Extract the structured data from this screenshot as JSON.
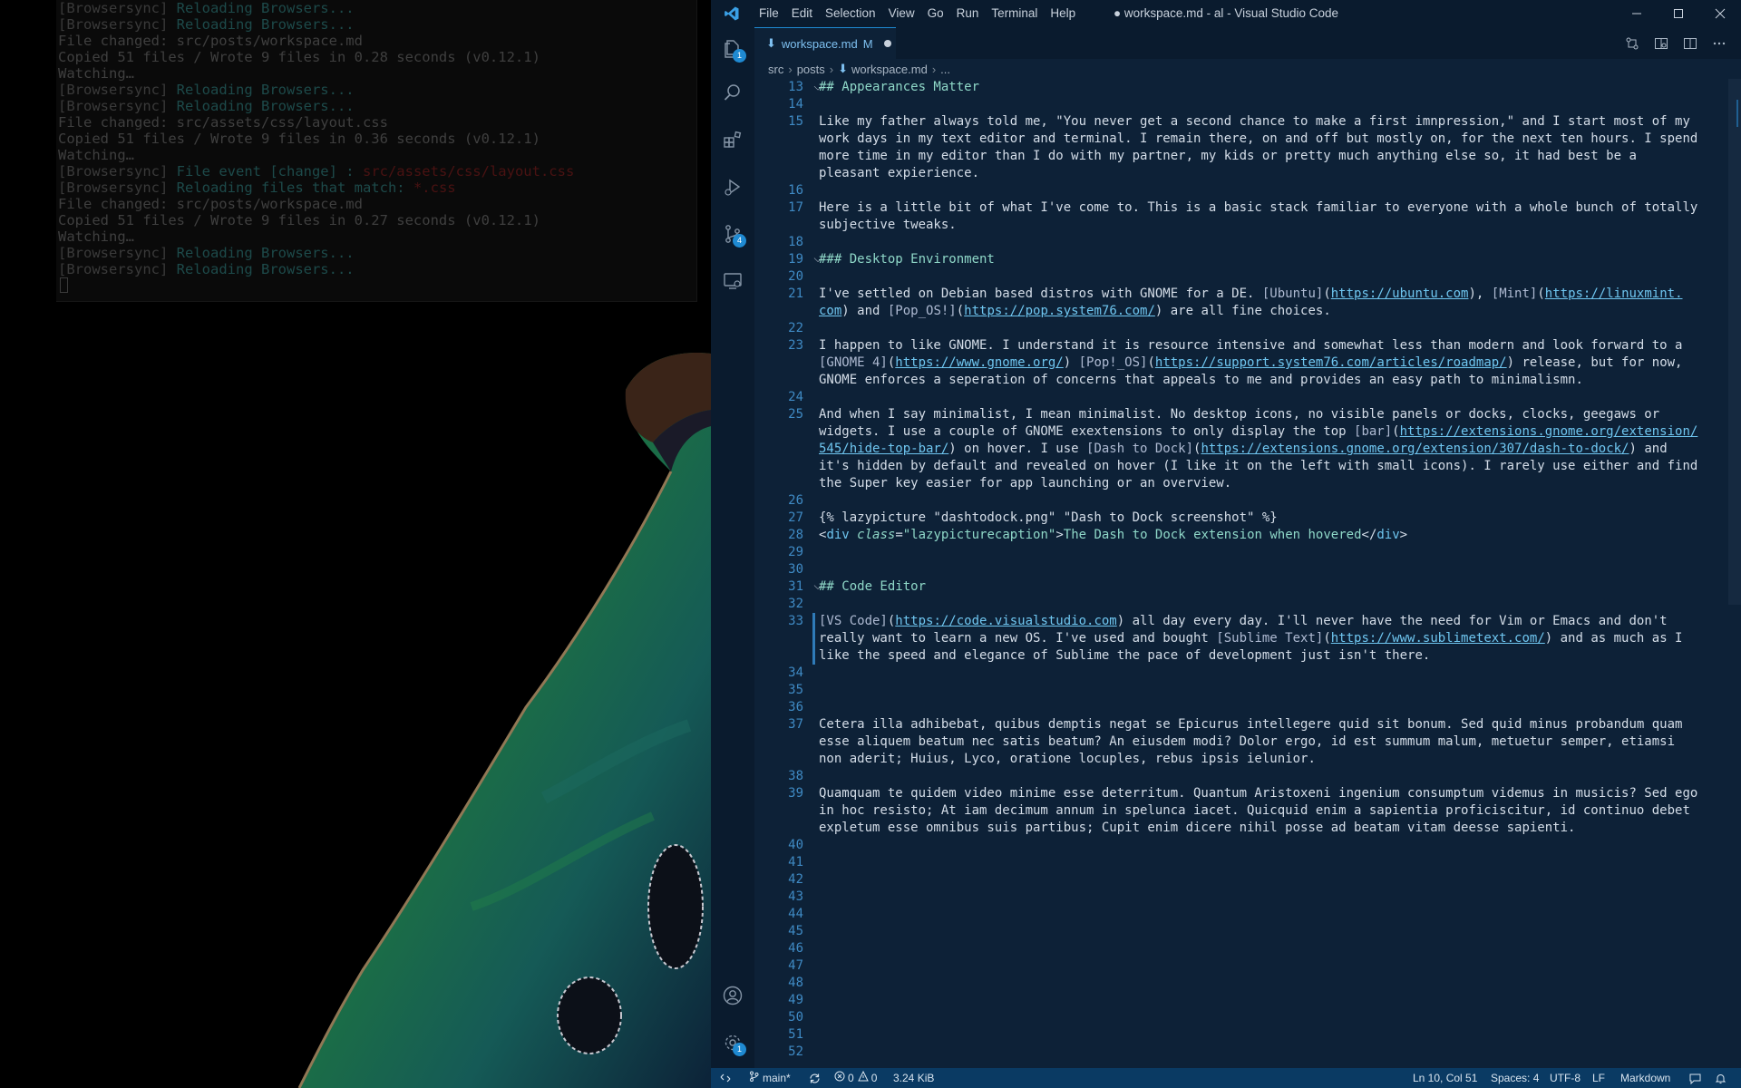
{
  "terminal": {
    "lines": [
      [
        {
          "t": "[",
          "c": "b"
        },
        {
          "t": "Browsersync",
          "c": "b"
        },
        {
          "t": "] ",
          "c": "b"
        },
        {
          "t": "Reloading Browsers...",
          "c": "cyan"
        }
      ],
      [
        {
          "t": "[",
          "c": "b"
        },
        {
          "t": "Browsersync",
          "c": "b"
        },
        {
          "t": "] ",
          "c": "b"
        },
        {
          "t": "Reloading Browsers...",
          "c": "cyan"
        }
      ],
      [
        {
          "t": "File changed: src/posts/workspace.md",
          "c": "n"
        }
      ],
      [
        {
          "t": "Copied 51 files / Wrote 9 files in 0.28 seconds (v0.12.1)",
          "c": "n"
        }
      ],
      [
        {
          "t": "Watching…",
          "c": "n"
        }
      ],
      [
        {
          "t": "[",
          "c": "b"
        },
        {
          "t": "Browsersync",
          "c": "b"
        },
        {
          "t": "] ",
          "c": "b"
        },
        {
          "t": "Reloading Browsers...",
          "c": "cyan"
        }
      ],
      [
        {
          "t": "[",
          "c": "b"
        },
        {
          "t": "Browsersync",
          "c": "b"
        },
        {
          "t": "] ",
          "c": "b"
        },
        {
          "t": "Reloading Browsers...",
          "c": "cyan"
        }
      ],
      [
        {
          "t": "File changed: src/assets/css/layout.css",
          "c": "n"
        }
      ],
      [
        {
          "t": "Copied 51 files / Wrote 9 files in 0.36 seconds (v0.12.1)",
          "c": "n"
        }
      ],
      [
        {
          "t": "Watching…",
          "c": "n"
        }
      ],
      [
        {
          "t": "[",
          "c": "b"
        },
        {
          "t": "Browsersync",
          "c": "b"
        },
        {
          "t": "] ",
          "c": "b"
        },
        {
          "t": "File event [change] : ",
          "c": "cyan"
        },
        {
          "t": "src/assets/css/layout.css",
          "c": "red"
        }
      ],
      [
        {
          "t": "[",
          "c": "b"
        },
        {
          "t": "Browsersync",
          "c": "b"
        },
        {
          "t": "] ",
          "c": "b"
        },
        {
          "t": "Reloading files that match: ",
          "c": "cyan"
        },
        {
          "t": "*.css",
          "c": "red"
        }
      ],
      [
        {
          "t": "File changed: src/posts/workspace.md",
          "c": "n"
        }
      ],
      [
        {
          "t": "Copied 51 files / Wrote 9 files in 0.27 seconds (v0.12.1)",
          "c": "n"
        }
      ],
      [
        {
          "t": "Watching…",
          "c": "n"
        }
      ],
      [
        {
          "t": "[",
          "c": "b"
        },
        {
          "t": "Browsersync",
          "c": "b"
        },
        {
          "t": "] ",
          "c": "b"
        },
        {
          "t": "Reloading Browsers...",
          "c": "cyan"
        }
      ],
      [
        {
          "t": "[",
          "c": "b"
        },
        {
          "t": "Browsersync",
          "c": "b"
        },
        {
          "t": "] ",
          "c": "b"
        },
        {
          "t": "Reloading Browsers...",
          "c": "cyan"
        }
      ]
    ]
  },
  "vscode": {
    "menu": [
      "File",
      "Edit",
      "Selection",
      "View",
      "Go",
      "Run",
      "Terminal",
      "Help"
    ],
    "window_title": "● workspace.md - al - Visual Studio Code",
    "activity_badges": {
      "explorer": "1",
      "source_control": "4",
      "settings": "1"
    },
    "tab": {
      "label": "workspace.md",
      "status": "M"
    },
    "breadcrumb": [
      "src",
      "posts",
      "workspace.md",
      "..."
    ],
    "editor_lines": [
      {
        "n": "13",
        "fold": true,
        "segs": [
          [
            "h",
            "## Appearances Matter"
          ]
        ]
      },
      {
        "n": "14",
        "segs": []
      },
      {
        "n": "15",
        "segs": [
          [
            "n",
            "Like my father always told me, \"You never get a second chance to make a first imnpression,\" and I start most of my"
          ]
        ]
      },
      {
        "n": "",
        "segs": [
          [
            "n",
            "work days in my text editor and terminal. I remain there, on and off but mostly on, for the next ten hours. I spend"
          ]
        ]
      },
      {
        "n": "",
        "segs": [
          [
            "n",
            "more time in my editor than I do with my partner, my kids or pretty much anything else so, it had best be a"
          ]
        ]
      },
      {
        "n": "",
        "segs": [
          [
            "n",
            "pleasant expierience."
          ]
        ]
      },
      {
        "n": "16",
        "segs": []
      },
      {
        "n": "17",
        "segs": [
          [
            "n",
            "Here is a little bit of what I've come to. This is a basic stack familiar to everyone with a whole bunch of totally"
          ]
        ]
      },
      {
        "n": "",
        "segs": [
          [
            "n",
            "subjective tweaks."
          ]
        ]
      },
      {
        "n": "18",
        "segs": []
      },
      {
        "n": "19",
        "fold": true,
        "segs": [
          [
            "h",
            "### Desktop Environment"
          ]
        ]
      },
      {
        "n": "20",
        "segs": []
      },
      {
        "n": "21",
        "segs": [
          [
            "n",
            "I've settled on Debian based distros with GNOME for a DE. "
          ],
          [
            "br",
            "[Ubuntu]"
          ],
          [
            "n",
            "("
          ],
          [
            "lk",
            "https://ubuntu.com"
          ],
          [
            "n",
            "), "
          ],
          [
            "br",
            "[Mint]"
          ],
          [
            "n",
            "("
          ],
          [
            "lk",
            "https://linuxmint."
          ]
        ]
      },
      {
        "n": "",
        "segs": [
          [
            "lk",
            "com"
          ],
          [
            "n",
            ") and "
          ],
          [
            "br",
            "[Pop_OS!]"
          ],
          [
            "n",
            "("
          ],
          [
            "lk",
            "https://pop.system76.com/"
          ],
          [
            "n",
            ") are all fine choices."
          ]
        ]
      },
      {
        "n": "22",
        "segs": []
      },
      {
        "n": "23",
        "segs": [
          [
            "n",
            "I happen to like GNOME. I understand it is resource intensive and somewhat less than modern and look forward to a"
          ]
        ]
      },
      {
        "n": "",
        "segs": [
          [
            "br",
            "[GNOME 4]"
          ],
          [
            "n",
            "("
          ],
          [
            "lk",
            "https://www.gnome.org/"
          ],
          [
            "n",
            ") "
          ],
          [
            "br",
            "[Pop!_OS]"
          ],
          [
            "n",
            "("
          ],
          [
            "lk",
            "https://support.system76.com/articles/roadmap/"
          ],
          [
            "n",
            ") release, but for now,"
          ]
        ]
      },
      {
        "n": "",
        "segs": [
          [
            "n",
            "GNOME enforces a seperation of concerns that appeals to me and provides an easy path to minimalismn."
          ]
        ]
      },
      {
        "n": "24",
        "segs": []
      },
      {
        "n": "25",
        "segs": [
          [
            "n",
            "And when I say minimalist, I mean minimalist. No desktop icons, no visible panels or docks, clocks, geegaws or"
          ]
        ]
      },
      {
        "n": "",
        "segs": [
          [
            "n",
            "widgets. I use a couple of GNOME exextensions to only display the top "
          ],
          [
            "br",
            "[bar]"
          ],
          [
            "n",
            "("
          ],
          [
            "lk",
            "https://extensions.gnome.org/extension/"
          ]
        ]
      },
      {
        "n": "",
        "segs": [
          [
            "lk",
            "545/hide-top-bar/"
          ],
          [
            "n",
            ") on hover. I use "
          ],
          [
            "br",
            "[Dash to Dock]"
          ],
          [
            "n",
            "("
          ],
          [
            "lk",
            "https://extensions.gnome.org/extension/307/dash-to-dock/"
          ],
          [
            "n",
            ") and"
          ]
        ]
      },
      {
        "n": "",
        "segs": [
          [
            "n",
            "it's hidden by default and revealed on hover (I like it on the left with small icons). I rarely use either and find"
          ]
        ]
      },
      {
        "n": "",
        "segs": [
          [
            "n",
            "the Super key easier for app launching or an overview."
          ]
        ]
      },
      {
        "n": "26",
        "segs": []
      },
      {
        "n": "27",
        "segs": [
          [
            "n",
            "{% lazypicture \"dashtodock.png\" \"Dash to Dock screenshot\" %}"
          ]
        ]
      },
      {
        "n": "28",
        "segs": [
          [
            "n",
            "<"
          ],
          [
            "tag",
            "div"
          ],
          [
            "n",
            " "
          ],
          [
            "attr",
            "class"
          ],
          [
            "n",
            "="
          ],
          [
            "str",
            "\"lazypicturecaption\""
          ],
          [
            "n",
            ">"
          ],
          [
            "str",
            "The Dash to Dock extension when hovered"
          ],
          [
            "n",
            "</"
          ],
          [
            "tag",
            "div"
          ],
          [
            "n",
            ">"
          ]
        ]
      },
      {
        "n": "29",
        "segs": []
      },
      {
        "n": "30",
        "segs": []
      },
      {
        "n": "31",
        "fold": true,
        "segs": [
          [
            "h",
            "## Code Editor"
          ]
        ]
      },
      {
        "n": "32",
        "segs": []
      },
      {
        "n": "33",
        "segs": [
          [
            "br",
            "[VS Code]"
          ],
          [
            "n",
            "("
          ],
          [
            "lk",
            "https://code.visualstudio.com"
          ],
          [
            "n",
            ") all day every day. I'll never have the need for Vim or Emacs and don't"
          ]
        ]
      },
      {
        "n": "",
        "segs": [
          [
            "n",
            "really want to learn a new OS. I've used and bought "
          ],
          [
            "br",
            "[Sublime Text]"
          ],
          [
            "n",
            "("
          ],
          [
            "lk",
            "https://www.sublimetext.com/"
          ],
          [
            "n",
            ") and as much as I"
          ]
        ]
      },
      {
        "n": "",
        "segs": [
          [
            "n",
            "like the speed and elegance of Sublime the pace of development just isn't there."
          ]
        ]
      },
      {
        "n": "34",
        "segs": []
      },
      {
        "n": "35",
        "segs": []
      },
      {
        "n": "36",
        "segs": []
      },
      {
        "n": "37",
        "segs": [
          [
            "n",
            "Cetera illa adhibebat, quibus demptis negat se Epicurus intellegere quid sit bonum. Sed quid minus probandum quam"
          ]
        ]
      },
      {
        "n": "",
        "segs": [
          [
            "n",
            "esse aliquem beatum nec satis beatum? An eiusdem modi? Dolor ergo, id est summum malum, metuetur semper, etiamsi"
          ]
        ]
      },
      {
        "n": "",
        "segs": [
          [
            "n",
            "non aderit; Huius, Lyco, oratione locuples, rebus ipsis ielunior."
          ]
        ]
      },
      {
        "n": "38",
        "segs": []
      },
      {
        "n": "39",
        "segs": [
          [
            "n",
            "Quamquam te quidem video minime esse deterritum. Quantum Aristoxeni ingenium consumptum videmus in musicis? Sed ego"
          ]
        ]
      },
      {
        "n": "",
        "segs": [
          [
            "n",
            "in hoc resisto; At iam decimum annum in spelunca iacet. Quicquid enim a sapientia proficiscitur, id continuo debet"
          ]
        ]
      },
      {
        "n": "",
        "segs": [
          [
            "n",
            "expletum esse omnibus suis partibus; Cupit enim dicere nihil posse ad beatam vitam deesse sapienti."
          ]
        ]
      },
      {
        "n": "40",
        "segs": []
      },
      {
        "n": "41",
        "segs": []
      },
      {
        "n": "42",
        "segs": []
      },
      {
        "n": "43",
        "segs": []
      },
      {
        "n": "44",
        "segs": []
      },
      {
        "n": "45",
        "segs": []
      },
      {
        "n": "46",
        "segs": []
      },
      {
        "n": "47",
        "segs": []
      },
      {
        "n": "48",
        "segs": []
      },
      {
        "n": "49",
        "segs": []
      },
      {
        "n": "50",
        "segs": []
      },
      {
        "n": "51",
        "segs": []
      },
      {
        "n": "52",
        "segs": []
      }
    ],
    "status": {
      "branch": "main*",
      "errors": "0",
      "warnings": "0",
      "size": "3.24 KiB",
      "cursor": "Ln 10, Col 51",
      "spaces": "Spaces: 4",
      "encoding": "UTF-8",
      "eol": "LF",
      "language": "Markdown"
    }
  },
  "colors": {
    "editor_bg": "#0d2137",
    "statusbar_bg": "#0a3a63",
    "accent": "#1f8ad2"
  }
}
